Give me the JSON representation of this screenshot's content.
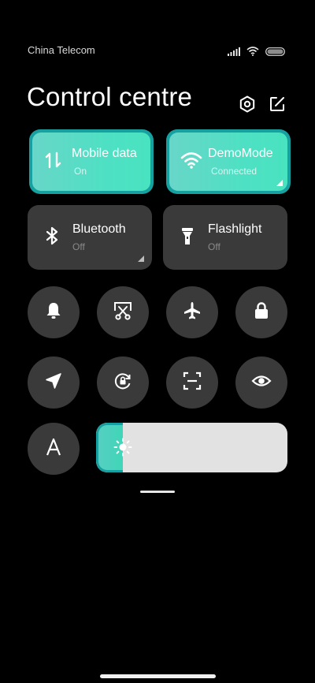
{
  "status": {
    "carrier": "China Telecom",
    "icons": [
      "signal-icon",
      "wifi-icon",
      "battery-icon"
    ]
  },
  "header": {
    "title": "Control centre",
    "icons": [
      "settings-icon",
      "edit-icon"
    ]
  },
  "tiles": [
    {
      "label": "Mobile data",
      "sub": "On",
      "state": "active",
      "icon": "mobile-data-icon"
    },
    {
      "label": "DemoMode",
      "sub": "Connected",
      "state": "active",
      "icon": "wifi-icon"
    },
    {
      "label": "Bluetooth",
      "sub": "Off",
      "state": "inactive",
      "icon": "bluetooth-icon"
    },
    {
      "label": "Flashlight",
      "sub": "Off",
      "state": "inactive",
      "icon": "flashlight-icon"
    }
  ],
  "toggles": [
    "bell-icon",
    "screenshot-icon",
    "airplane-icon",
    "lock-icon",
    "location-icon",
    "rotation-lock-icon",
    "scanner-icon",
    "eye-icon",
    "font-size-icon"
  ],
  "brightness": {
    "level": 0.14,
    "icon": "sun-icon"
  },
  "colors": {
    "accent_border": "#17a0a0",
    "accent_fill": "#4fe0c4",
    "tile_inactive": "#3a3a3a",
    "background": "#000000"
  }
}
